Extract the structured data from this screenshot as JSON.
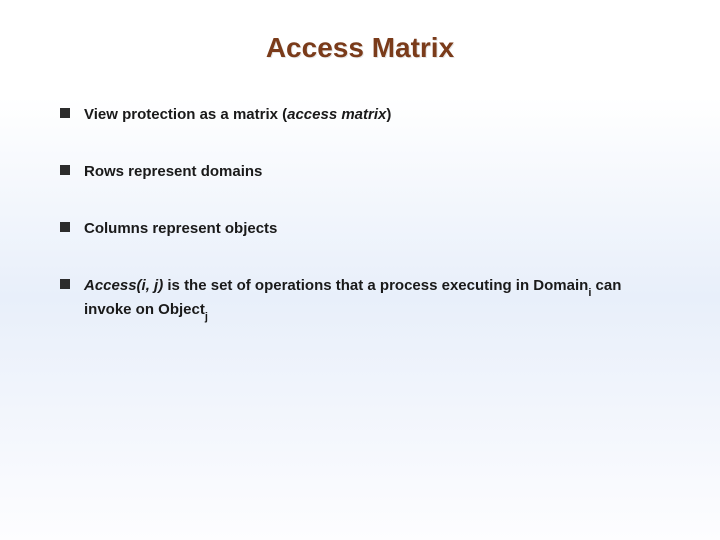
{
  "title": "Access Matrix",
  "bullets": {
    "b0": {
      "pre": "View protection as a matrix (",
      "italic": "access matrix",
      "post": ")"
    },
    "b1": "Rows represent domains",
    "b2": "Columns represent objects",
    "b3": {
      "leadItalic": "Access(i, j)",
      "mid1": " is the set of operations that a process executing in Domain",
      "sub1": "i",
      "mid2": " can invoke on Object",
      "sub2": "j"
    }
  }
}
